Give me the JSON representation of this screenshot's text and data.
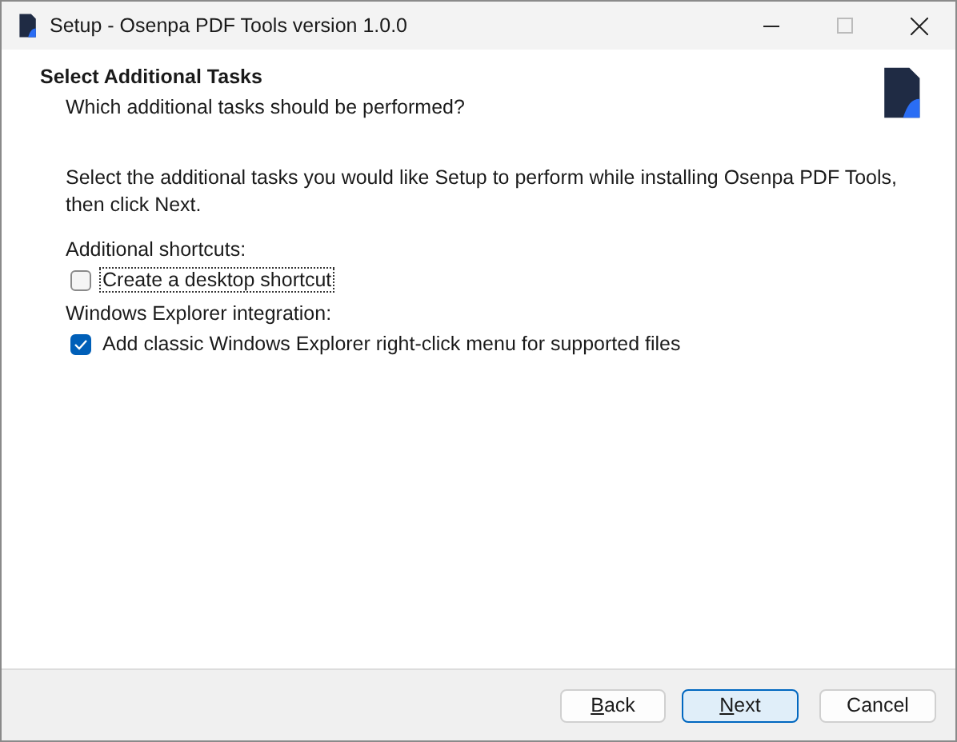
{
  "window": {
    "title": "Setup - Osenpa PDF Tools version 1.0.0"
  },
  "header": {
    "title": "Select Additional Tasks",
    "subtitle": "Which additional tasks should be performed?"
  },
  "intro": "Select the additional tasks you would like Setup to perform while installing Osenpa PDF Tools, then click Next.",
  "groups": [
    {
      "label": "Additional shortcuts:",
      "tasks": [
        {
          "label": "Create a desktop shortcut",
          "checked": false,
          "focused": true
        }
      ]
    },
    {
      "label": "Windows Explorer integration:",
      "tasks": [
        {
          "label": "Add classic Windows Explorer right-click menu for supported files",
          "checked": true,
          "focused": false
        }
      ]
    }
  ],
  "buttons": [
    {
      "label": "Back",
      "selected": false,
      "underline_first": true
    },
    {
      "label": "Next",
      "selected": true,
      "underline_first": true
    },
    {
      "label": "Cancel",
      "selected": false,
      "underline_first": false
    }
  ]
}
